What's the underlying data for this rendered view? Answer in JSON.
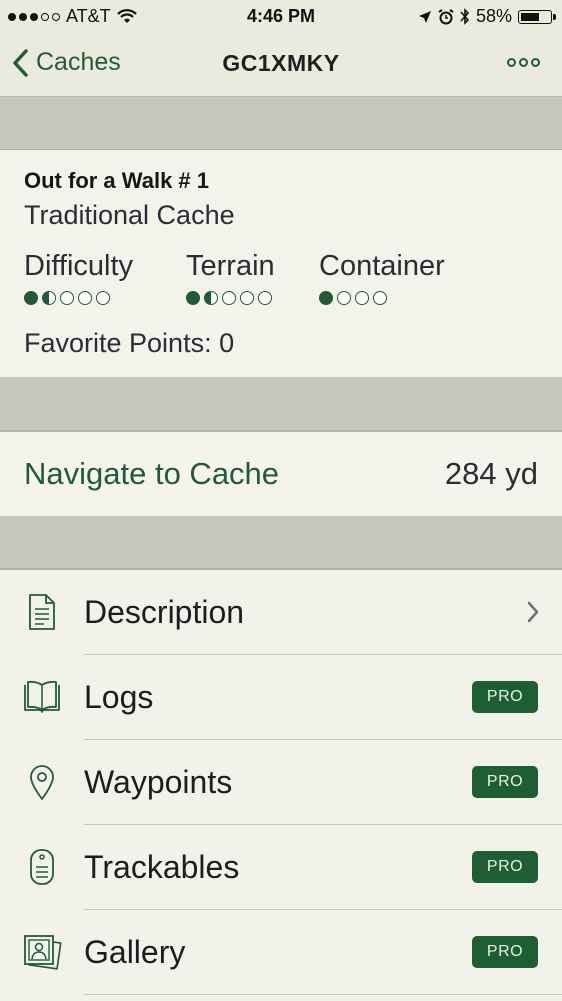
{
  "status_bar": {
    "carrier": "AT&T",
    "time": "4:46 PM",
    "battery": "58%"
  },
  "nav": {
    "back_label": "Caches",
    "title": "GC1XMKY"
  },
  "cache": {
    "name": "Out for a Walk # 1",
    "type": "Traditional Cache",
    "difficulty_label": "Difficulty",
    "difficulty_value": 1.5,
    "terrain_label": "Terrain",
    "terrain_value": 1.5,
    "container_label": "Container",
    "container_value": 1,
    "favorite_points": "Favorite Points: 0"
  },
  "navigate": {
    "label": "Navigate to Cache",
    "distance": "284 yd"
  },
  "menu": [
    {
      "label": "Description",
      "icon": "document-icon",
      "pro": false
    },
    {
      "label": "Logs",
      "icon": "book-icon",
      "pro": true,
      "badge": "PRO"
    },
    {
      "label": "Waypoints",
      "icon": "map-pin-icon",
      "pro": true,
      "badge": "PRO"
    },
    {
      "label": "Trackables",
      "icon": "trackable-tag-icon",
      "pro": true,
      "badge": "PRO"
    },
    {
      "label": "Gallery",
      "icon": "photo-gallery-icon",
      "pro": true,
      "badge": "PRO"
    }
  ],
  "colors": {
    "accent": "#1e5d35",
    "pro_badge": "#1d5f33",
    "background": "#f3f2ea",
    "separator_band": "#c8c7bd"
  }
}
